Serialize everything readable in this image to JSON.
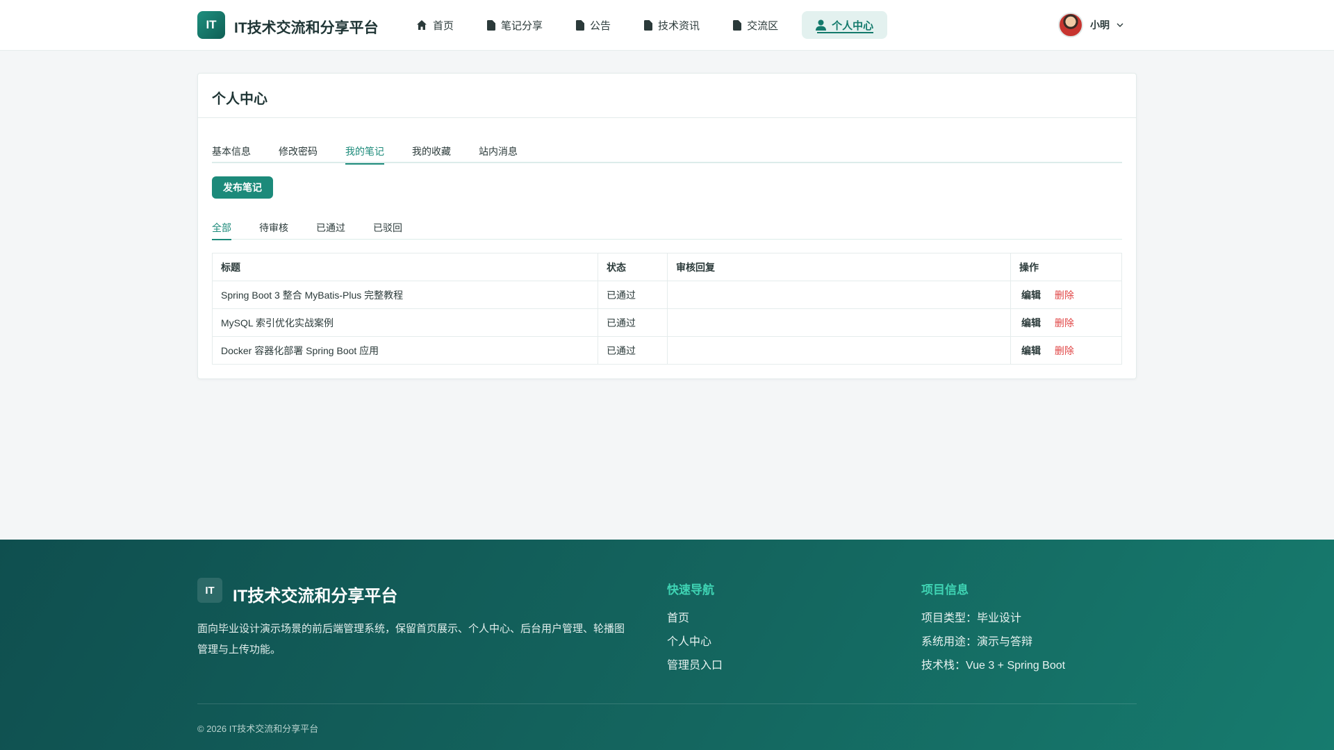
{
  "header": {
    "logo_badge": "IT",
    "site_title": "IT技术交流和分享平台",
    "nav": [
      {
        "label": "首页",
        "icon": "home-icon"
      },
      {
        "label": "笔记分享",
        "icon": "document-icon"
      },
      {
        "label": "公告",
        "icon": "document-icon"
      },
      {
        "label": "技术资讯",
        "icon": "document-icon"
      },
      {
        "label": "交流区",
        "icon": "document-icon"
      },
      {
        "label": "个人中心",
        "icon": "user-icon",
        "active": true
      }
    ],
    "user": {
      "name": "小明"
    }
  },
  "card": {
    "title": "个人中心",
    "tabs": [
      "基本信息",
      "修改密码",
      "我的笔记",
      "我的收藏",
      "站内消息"
    ],
    "active_tab": "我的笔记",
    "publish_button": "发布笔记",
    "subtabs": [
      "全部",
      "待审核",
      "已通过",
      "已驳回"
    ],
    "active_subtab": "全部",
    "table": {
      "headers": [
        "标题",
        "状态",
        "审核回复",
        "操作"
      ],
      "rows": [
        {
          "title": "Spring Boot 3 整合 MyBatis-Plus 完整教程",
          "status": "已通过",
          "reply": "",
          "edit": "编辑",
          "delete": "删除"
        },
        {
          "title": "MySQL 索引优化实战案例",
          "status": "已通过",
          "reply": "",
          "edit": "编辑",
          "delete": "删除"
        },
        {
          "title": "Docker 容器化部署 Spring Boot 应用",
          "status": "已通过",
          "reply": "",
          "edit": "编辑",
          "delete": "删除"
        }
      ]
    }
  },
  "footer": {
    "badge": "IT",
    "brand": "IT技术交流和分享平台",
    "description": "面向毕业设计演示场景的前后端管理系统，保留首页展示、个人中心、后台用户管理、轮播图管理与上传功能。",
    "quick_nav": {
      "heading": "快速导航",
      "items": [
        "首页",
        "个人中心",
        "管理员入口"
      ]
    },
    "project_info": {
      "heading": "项目信息",
      "items": [
        "项目类型：毕业设计",
        "系统用途：演示与答辩",
        "技术栈：Vue 3 + Spring Boot"
      ]
    },
    "copyright": "© 2026 IT技术交流和分享平台"
  },
  "colors": {
    "accent": "#1c8a7a",
    "danger": "#e04444",
    "footer_bg": "#14665f",
    "footer_heading": "#3fd3b3"
  }
}
